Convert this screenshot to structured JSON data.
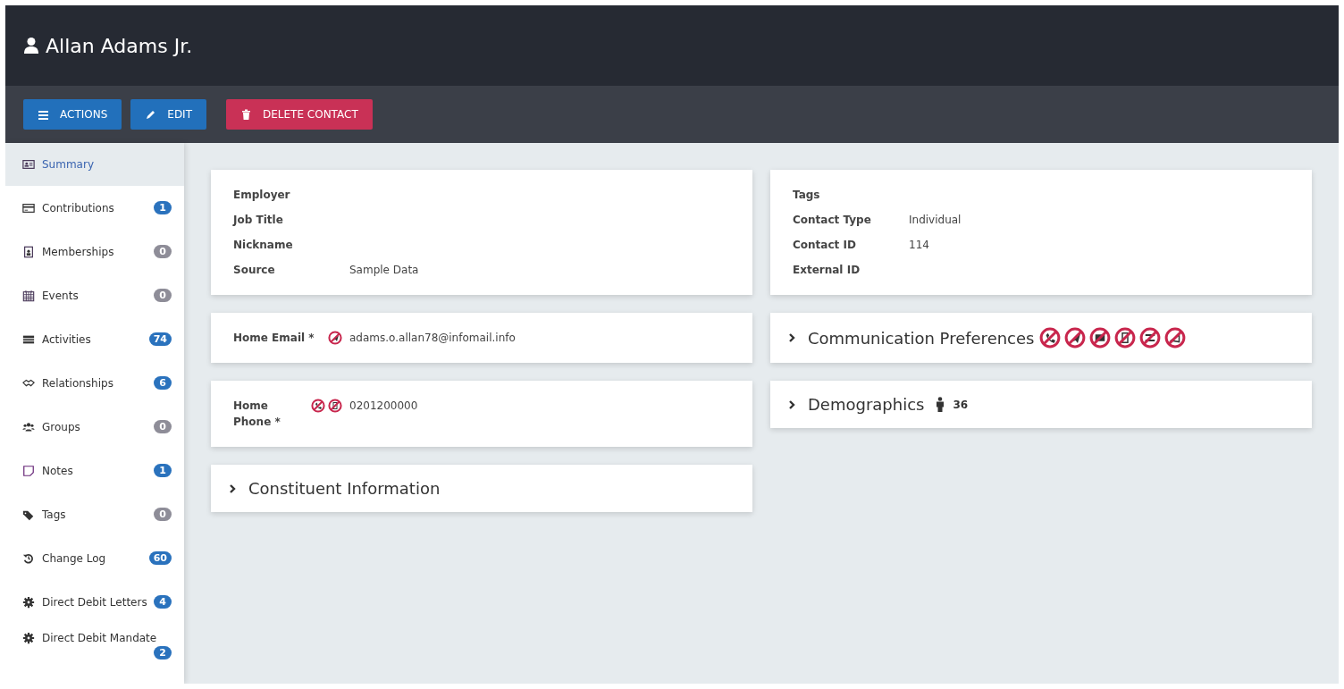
{
  "header": {
    "title": "Allan Adams Jr."
  },
  "toolbar": {
    "buttons": [
      {
        "label": "ACTIONS",
        "kind": "actions"
      },
      {
        "label": "EDIT",
        "kind": "edit"
      },
      {
        "label": "DELETE CONTACT",
        "kind": "delete"
      }
    ]
  },
  "sidebar": {
    "items": [
      {
        "label": "Summary",
        "selected": true
      },
      {
        "label": "Contributions",
        "selected": false,
        "count": "1",
        "color": "#2a72bd"
      },
      {
        "label": "Memberships",
        "selected": false,
        "count": "0",
        "color": "#8e8d98"
      },
      {
        "label": "Events",
        "selected": false,
        "count": "0",
        "color": "#8e8d98"
      },
      {
        "label": "Activities",
        "selected": false,
        "count": "74",
        "color": "#2a72bd"
      },
      {
        "label": "Relationships",
        "selected": false,
        "count": "6",
        "color": "#2a72bd"
      },
      {
        "label": "Groups",
        "selected": false,
        "count": "0",
        "color": "#8e8d98"
      },
      {
        "label": "Notes",
        "selected": false,
        "count": "1",
        "color": "#2a72bd"
      },
      {
        "label": "Tags",
        "selected": false,
        "count": "0",
        "color": "#8e8d98"
      },
      {
        "label": "Change Log",
        "selected": false,
        "count": "60",
        "color": "#2a72bd"
      },
      {
        "label": "Direct Debit Letters",
        "selected": false,
        "count": "4",
        "color": "#2a72bd"
      },
      {
        "label": "Direct Debit Mandate",
        "selected": false,
        "count": "2",
        "color": "#2a72bd"
      }
    ]
  },
  "left_panels": [
    {
      "kind": "fields",
      "fields": [
        {
          "kind": "text",
          "label": "Employer"
        },
        {
          "kind": "text",
          "label": "Job Title"
        },
        {
          "kind": "text",
          "label": "Nickname"
        },
        {
          "kind": "text",
          "label": "Source",
          "value": "Sample Data"
        }
      ]
    },
    {
      "kind": "fields",
      "fields": [
        {
          "kind": "email",
          "label": "Home Email *",
          "value": "adams.o.allan78@infomail.info"
        }
      ]
    },
    {
      "kind": "fields",
      "fields": [
        {
          "kind": "phone",
          "label": "Home Phone *",
          "value": "0201200000"
        }
      ]
    },
    {
      "kind": "collapsible",
      "title": "Constituent Information",
      "expanded": false
    }
  ],
  "right_panels": [
    {
      "kind": "fields",
      "fields": [
        {
          "kind": "text",
          "label": "Tags"
        },
        {
          "kind": "text",
          "label": "Contact Type",
          "value": "Individual"
        },
        {
          "kind": "text",
          "label": "Contact ID",
          "value": "114"
        },
        {
          "kind": "text",
          "label": "External ID"
        }
      ]
    },
    {
      "kind": "preferences",
      "title": "Communication Preferences",
      "expanded": false
    },
    {
      "kind": "demographics",
      "title": "Demographics",
      "expanded": false,
      "age": "36"
    }
  ]
}
